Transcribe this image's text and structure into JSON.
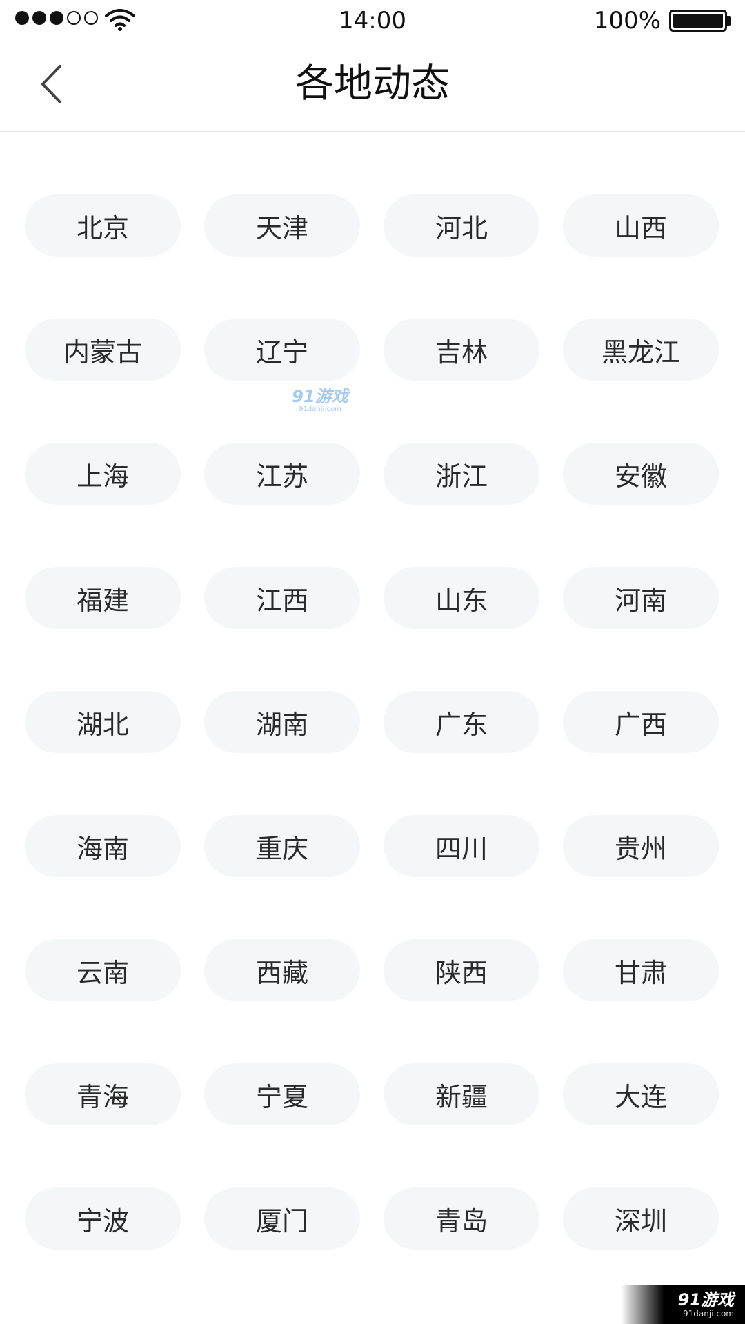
{
  "status_bar": {
    "time": "14:00",
    "battery": "100%",
    "signal_bars_filled": 3,
    "signal_bars_total": 5
  },
  "nav": {
    "title": "各地动态",
    "back_icon": "chevron-left-icon"
  },
  "regions": [
    "北京",
    "天津",
    "河北",
    "山西",
    "内蒙古",
    "辽宁",
    "吉林",
    "黑龙江",
    "上海",
    "江苏",
    "浙江",
    "安徽",
    "福建",
    "江西",
    "山东",
    "河南",
    "湖北",
    "湖南",
    "广东",
    "广西",
    "海南",
    "重庆",
    "四川",
    "贵州",
    "云南",
    "西藏",
    "陕西",
    "甘肃",
    "青海",
    "宁夏",
    "新疆",
    "大连",
    "宁波",
    "厦门",
    "青岛",
    "深圳"
  ],
  "watermark": {
    "center_main": "91游戏",
    "center_sub": "91danji.com",
    "corner_main": "91游戏",
    "corner_sub": "91danji.com"
  },
  "colors": {
    "chip_background": "#f5f6f8",
    "text": "#2a2a2a",
    "divider": "#e6e6e6"
  }
}
